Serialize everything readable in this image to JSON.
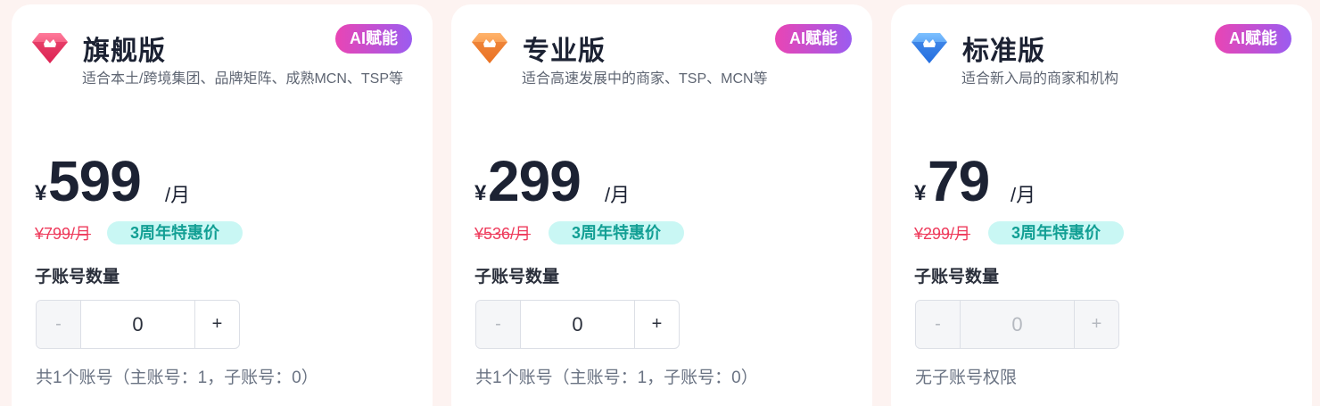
{
  "plans": [
    {
      "name": "旗舰版",
      "badge": "AI赋能",
      "description": "适合本土/跨境集团、品牌矩阵、成熟MCN、TSP等",
      "currency": "¥",
      "price": "599",
      "unit": "/月",
      "original_price": "¥799/月",
      "promo": "3周年特惠价",
      "sub_account_label": "子账号数量",
      "stepper": {
        "minus": "-",
        "value": "0",
        "plus": "+",
        "disabled": false
      },
      "note": "共1个账号（主账号：1，子账号：0）",
      "gem_color": "#f0466e"
    },
    {
      "name": "专业版",
      "badge": "AI赋能",
      "description": "适合高速发展中的商家、TSP、MCN等",
      "currency": "¥",
      "price": "299",
      "unit": "/月",
      "original_price": "¥536/月",
      "promo": "3周年特惠价",
      "sub_account_label": "子账号数量",
      "stepper": {
        "minus": "-",
        "value": "0",
        "plus": "+",
        "disabled": false
      },
      "note": "共1个账号（主账号：1，子账号：0）",
      "gem_color": "#f58a3c"
    },
    {
      "name": "标准版",
      "badge": "AI赋能",
      "description": "适合新入局的商家和机构",
      "currency": "¥",
      "price": "79",
      "unit": "/月",
      "original_price": "¥299/月",
      "promo": "3周年特惠价",
      "sub_account_label": "子账号数量",
      "stepper": {
        "minus": "-",
        "value": "0",
        "plus": "+",
        "disabled": true
      },
      "note": "无子账号权限",
      "gem_color": "#3a8cf0"
    }
  ],
  "colors": {
    "background": "#fdf3f1",
    "badge_gradient_start": "#e945b4",
    "badge_gradient_end": "#9b5cf0",
    "strike_price": "#ee3a5b",
    "promo_bg": "#c9f7f4",
    "promo_text": "#129f94"
  },
  "icons": {
    "gem": "diamond-crown-icon"
  }
}
